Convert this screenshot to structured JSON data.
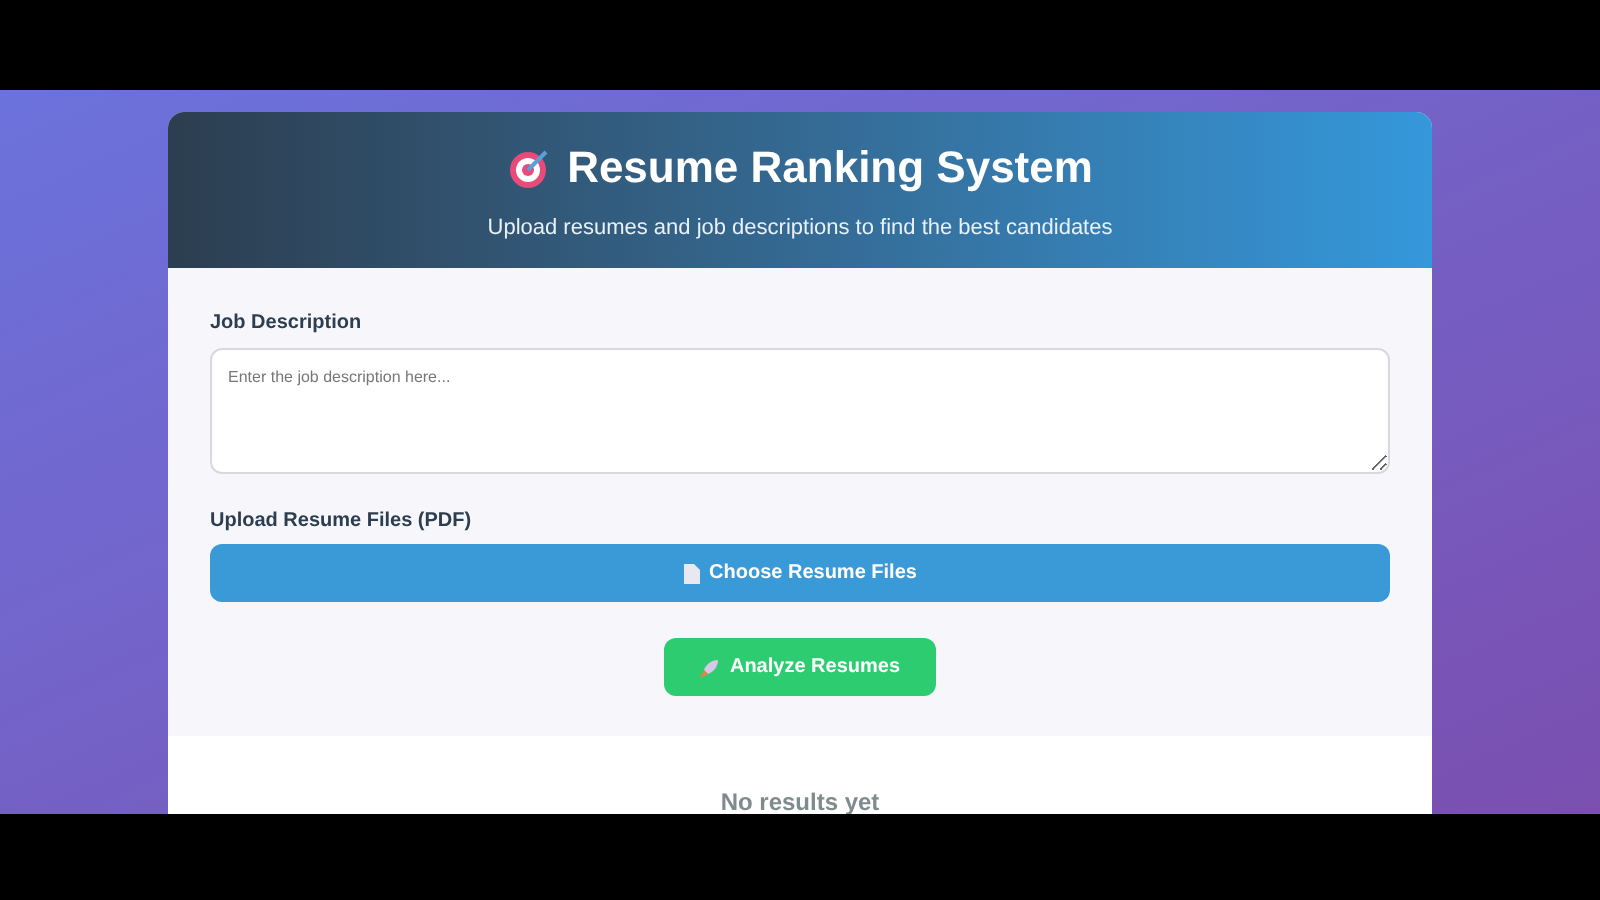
{
  "header": {
    "title": "Resume Ranking System",
    "subtitle": "Upload resumes and job descriptions to find the best candidates"
  },
  "job_description": {
    "label": "Job Description",
    "placeholder": "Enter the job description here..."
  },
  "upload": {
    "label": "Upload Resume Files (PDF)",
    "button": "Choose Resume Files"
  },
  "analyze_button": "Analyze Resumes",
  "results": {
    "empty_message": "No results yet"
  }
}
